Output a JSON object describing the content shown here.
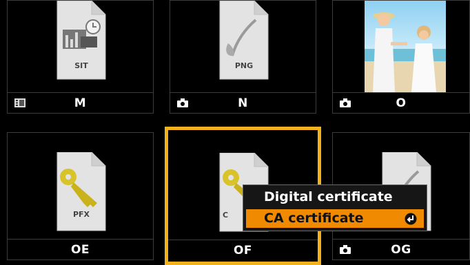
{
  "tiles": [
    {
      "label": "M",
      "doc_type": "SIT",
      "type_icon": "media-list-icon"
    },
    {
      "label": "N",
      "doc_type": "PNG",
      "type_icon": "camera-icon"
    },
    {
      "label": "O",
      "doc_type": "",
      "type_icon": "camera-icon"
    },
    {
      "label": "OE",
      "doc_type": "PFX",
      "type_icon": ""
    },
    {
      "label": "OF",
      "doc_type": "C",
      "type_icon": ""
    },
    {
      "label": "OG",
      "doc_type": "",
      "type_icon": "camera-icon"
    }
  ],
  "menu": {
    "items": [
      {
        "label": "Digital certificate",
        "selected": false
      },
      {
        "label": "CA certificate",
        "selected": true
      }
    ]
  },
  "colors": {
    "selection_border": "#f1b21e",
    "menu_highlight": "#f08a00",
    "background": "#000000"
  }
}
